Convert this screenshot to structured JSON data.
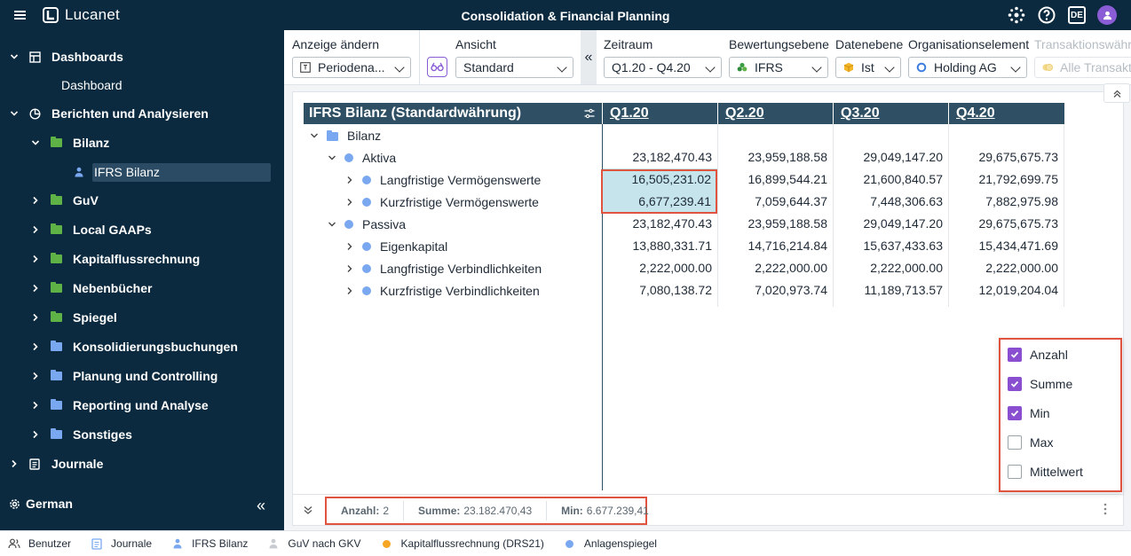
{
  "app": {
    "brand": "Lucanet",
    "title": "Consolidation & Financial Planning",
    "lang_badge": "DE"
  },
  "sidebar": {
    "items": [
      {
        "label": "Dashboards"
      },
      {
        "label": "Dashboard"
      },
      {
        "label": "Berichten und Analysieren"
      },
      {
        "label": "Bilanz"
      },
      {
        "label": "IFRS Bilanz"
      },
      {
        "label": "GuV"
      },
      {
        "label": "Local GAAPs"
      },
      {
        "label": "Kapitalflussrechnung"
      },
      {
        "label": "Nebenbücher"
      },
      {
        "label": "Spiegel"
      },
      {
        "label": "Konsolidierungsbuchungen"
      },
      {
        "label": "Planung und Controlling"
      },
      {
        "label": "Reporting und Analyse"
      },
      {
        "label": "Sonstiges"
      },
      {
        "label": "Journale"
      }
    ],
    "language": "German"
  },
  "toolbar": {
    "anzeige_label": "Anzeige ändern",
    "anzeige_value": "Periodena...",
    "ansicht_label": "Ansicht",
    "ansicht_value": "Standard",
    "zeitraum_label": "Zeitraum",
    "zeitraum_value": "Q1.20 - Q4.20",
    "bewertung_label": "Bewertungsebene",
    "bewertung_value": "IFRS",
    "daten_label": "Datenebene",
    "daten_value": "Ist",
    "org_label": "Organisationselement",
    "org_value": "Holding AG",
    "trans_label": "Transaktionswährung",
    "trans_value": "Alle Transaktionswährungen"
  },
  "report": {
    "title": "IFRS Bilanz (Standardwährung)",
    "columns": [
      "Q1.20",
      "Q2.20",
      "Q3.20",
      "Q4.20"
    ],
    "rows": [
      {
        "label": "Bilanz",
        "values": [
          "",
          "",
          "",
          ""
        ]
      },
      {
        "label": "Aktiva",
        "values": [
          "23,182,470.43",
          "23,959,188.58",
          "29,049,147.20",
          "29,675,675.73"
        ]
      },
      {
        "label": "Langfristige Vermögenswerte",
        "values": [
          "16,505,231.02",
          "16,899,544.21",
          "21,600,840.57",
          "21,792,699.75"
        ]
      },
      {
        "label": "Kurzfristige Vermögenswerte",
        "values": [
          "6,677,239.41",
          "7,059,644.37",
          "7,448,306.63",
          "7,882,975.98"
        ]
      },
      {
        "label": "Passiva",
        "values": [
          "23,182,470.43",
          "23,959,188.58",
          "29,049,147.20",
          "29,675,675.73"
        ]
      },
      {
        "label": "Eigenkapital",
        "values": [
          "13,880,331.71",
          "14,716,214.84",
          "15,637,433.63",
          "15,434,471.69"
        ]
      },
      {
        "label": "Langfristige Verbindlichkeiten",
        "values": [
          "2,222,000.00",
          "2,222,000.00",
          "2,222,000.00",
          "2,222,000.00"
        ]
      },
      {
        "label": "Kurzfristige Verbindlichkeiten",
        "values": [
          "7,080,138.72",
          "7,020,973.74",
          "11,189,713.57",
          "12,019,204.04"
        ]
      }
    ]
  },
  "stats": {
    "count_label": "Anzahl:",
    "count_value": "2",
    "sum_label": "Summe:",
    "sum_value": "23.182.470,43",
    "min_label": "Min:",
    "min_value": "6.677.239,41"
  },
  "aggregations": [
    {
      "label": "Anzahl",
      "checked": true
    },
    {
      "label": "Summe",
      "checked": true
    },
    {
      "label": "Min",
      "checked": true
    },
    {
      "label": "Max",
      "checked": false
    },
    {
      "label": "Mittelwert",
      "checked": false
    }
  ],
  "bottom_tabs": [
    {
      "label": "Benutzer"
    },
    {
      "label": "Journale"
    },
    {
      "label": "IFRS Bilanz"
    },
    {
      "label": "GuV nach GKV"
    },
    {
      "label": "Kapitalflussrechnung (DRS21)"
    },
    {
      "label": "Anlagenspiegel"
    }
  ],
  "colors": {
    "navy": "#0b2a3f",
    "header_teal": "#2f5064",
    "accent_purple": "#8a4fd0",
    "selection": "#c6e4ec",
    "highlight_red": "#e0543f",
    "folder_green": "#5fb246",
    "folder_blue": "#7aa8f0",
    "dot_orange": "#f5a623"
  }
}
